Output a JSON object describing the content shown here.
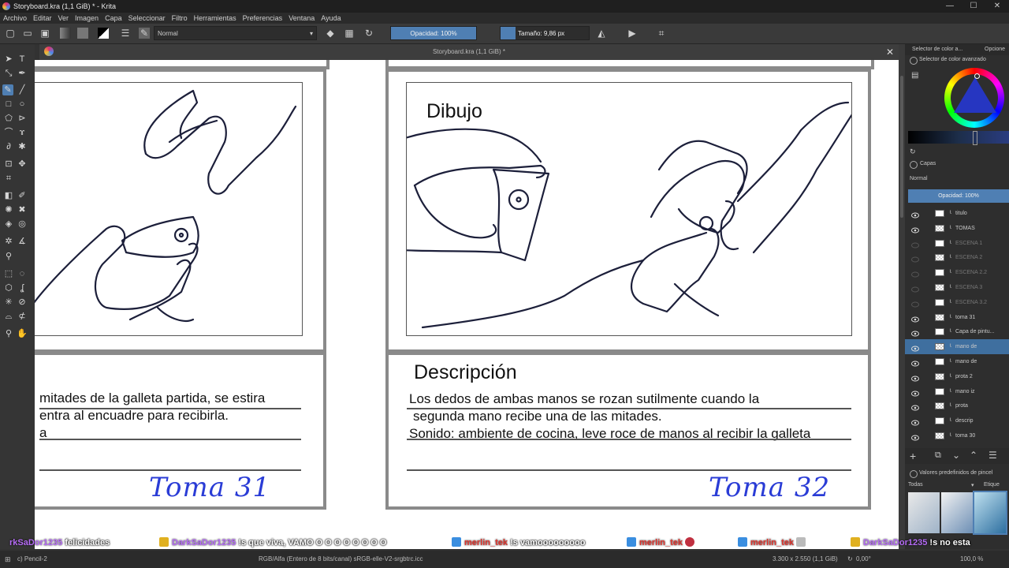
{
  "window": {
    "title": "Storyboard.kra (1,1 GiB) * - Krita"
  },
  "menu": [
    "Archivo",
    "Editar",
    "Ver",
    "Imagen",
    "Capa",
    "Seleccionar",
    "Filtro",
    "Herramientas",
    "Preferencias",
    "Ventana",
    "Ayuda"
  ],
  "toolbar": {
    "blend_mode": "Normal",
    "opacity": "Opacidad: 100%",
    "size": "Tamaño: 9,86 px"
  },
  "document_tab": {
    "label": "Storyboard.kra (1,1 GiB) *"
  },
  "canvas": {
    "left_panel": {
      "description_lines": [
        "mitades de la galleta partida, se estira",
        "entra al encuadre para recibirla.",
        "a"
      ],
      "shot_label": "Toma 31"
    },
    "right_panel": {
      "drawing_heading": "Dibujo",
      "description_heading": "Descripción",
      "description_lines": [
        "Los dedos de ambas manos se rozan sutilmente cuando la",
        "segunda mano recibe una de las mitades.",
        "Sonido: ambiente de cocina, leve roce de manos al recibir la galleta"
      ],
      "shot_label": "Toma 32"
    }
  },
  "docker": {
    "tabs": [
      "Selector de color a...",
      "Opcione"
    ],
    "color_selector_title": "Selector de color avanzado",
    "layers_title": "Capas",
    "layers_blend": "Normal",
    "layers_opacity": "Opacidad:  100%",
    "layers": [
      {
        "name": "titulo",
        "visible": true
      },
      {
        "name": "TOMAS",
        "visible": true
      },
      {
        "name": "ESCENA 1",
        "visible": false
      },
      {
        "name": "ESCENA 2",
        "visible": false
      },
      {
        "name": "ESCENA 2.2",
        "visible": false
      },
      {
        "name": "ESCENA 3",
        "visible": false
      },
      {
        "name": "ESCENA 3.2",
        "visible": false
      },
      {
        "name": "toma 31",
        "visible": true
      },
      {
        "name": "Capa de pintu...",
        "visible": true
      },
      {
        "name": "mano de",
        "visible": true,
        "selected": true
      },
      {
        "name": "mano de",
        "visible": true
      },
      {
        "name": "prota 2",
        "visible": true
      },
      {
        "name": "mano iz",
        "visible": true
      },
      {
        "name": "prota",
        "visible": true
      },
      {
        "name": "descrip",
        "visible": true
      },
      {
        "name": "toma 30",
        "visible": true
      }
    ],
    "brush_presets_title": "Valores predefinidos de pincel",
    "brush_filter": "Todas",
    "brush_tag": "Etique"
  },
  "chat": [
    {
      "user": "rkSaDor1235",
      "message": "felicidades",
      "user_color": "purple"
    },
    {
      "user": "DarkSaDor1235",
      "message": "!s que viva, VAMO O O O O O O O O",
      "user_color": "purple"
    },
    {
      "user": "merlin_tek",
      "message": "!s vamooooooooo",
      "user_color": "red"
    },
    {
      "user": "merlin_tek",
      "message": "",
      "user_color": "red"
    },
    {
      "user": "merlin_tek",
      "message": "",
      "user_color": "red"
    },
    {
      "user": "DarkSaDor1235",
      "message": "!s no esta",
      "user_color": "purple"
    }
  ],
  "status": {
    "brush": "c) Pencil-2",
    "color_space": "RGB/Alfa (Entero de 8 bits/canal)  sRGB-elle-V2-srgbtrc.icc",
    "dimensions": "3.300 x 2.550 (1,1 GiB)",
    "rotation": "0,00°",
    "zoom": "100,0 %"
  },
  "colors": {
    "accent": "#4f7fb3",
    "ink": "#1c1f3a",
    "shot_label": "#2a3cd6"
  }
}
